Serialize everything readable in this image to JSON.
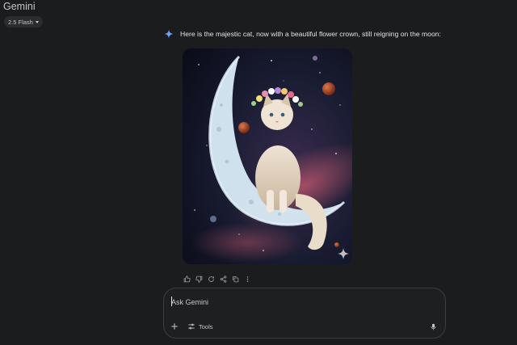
{
  "app": {
    "title": "Gemini",
    "model_label": "2.5 Flash"
  },
  "response": {
    "text": "Here is the majestic cat, now with a beautiful flower crown, still reigning on the moon:",
    "image_subject": "cat-with-flower-crown-on-crescent-moon"
  },
  "actions": [
    {
      "name": "thumbs-up-icon"
    },
    {
      "name": "thumbs-down-icon"
    },
    {
      "name": "regenerate-icon"
    },
    {
      "name": "share-icon"
    },
    {
      "name": "copy-icon"
    },
    {
      "name": "more-icon"
    }
  ],
  "composer": {
    "placeholder": "Ask Gemini",
    "tools_label": "Tools"
  },
  "colors": {
    "background": "#1b1c1d",
    "composer_border": "#3c3d3f",
    "accent": "#4f8ff7"
  }
}
